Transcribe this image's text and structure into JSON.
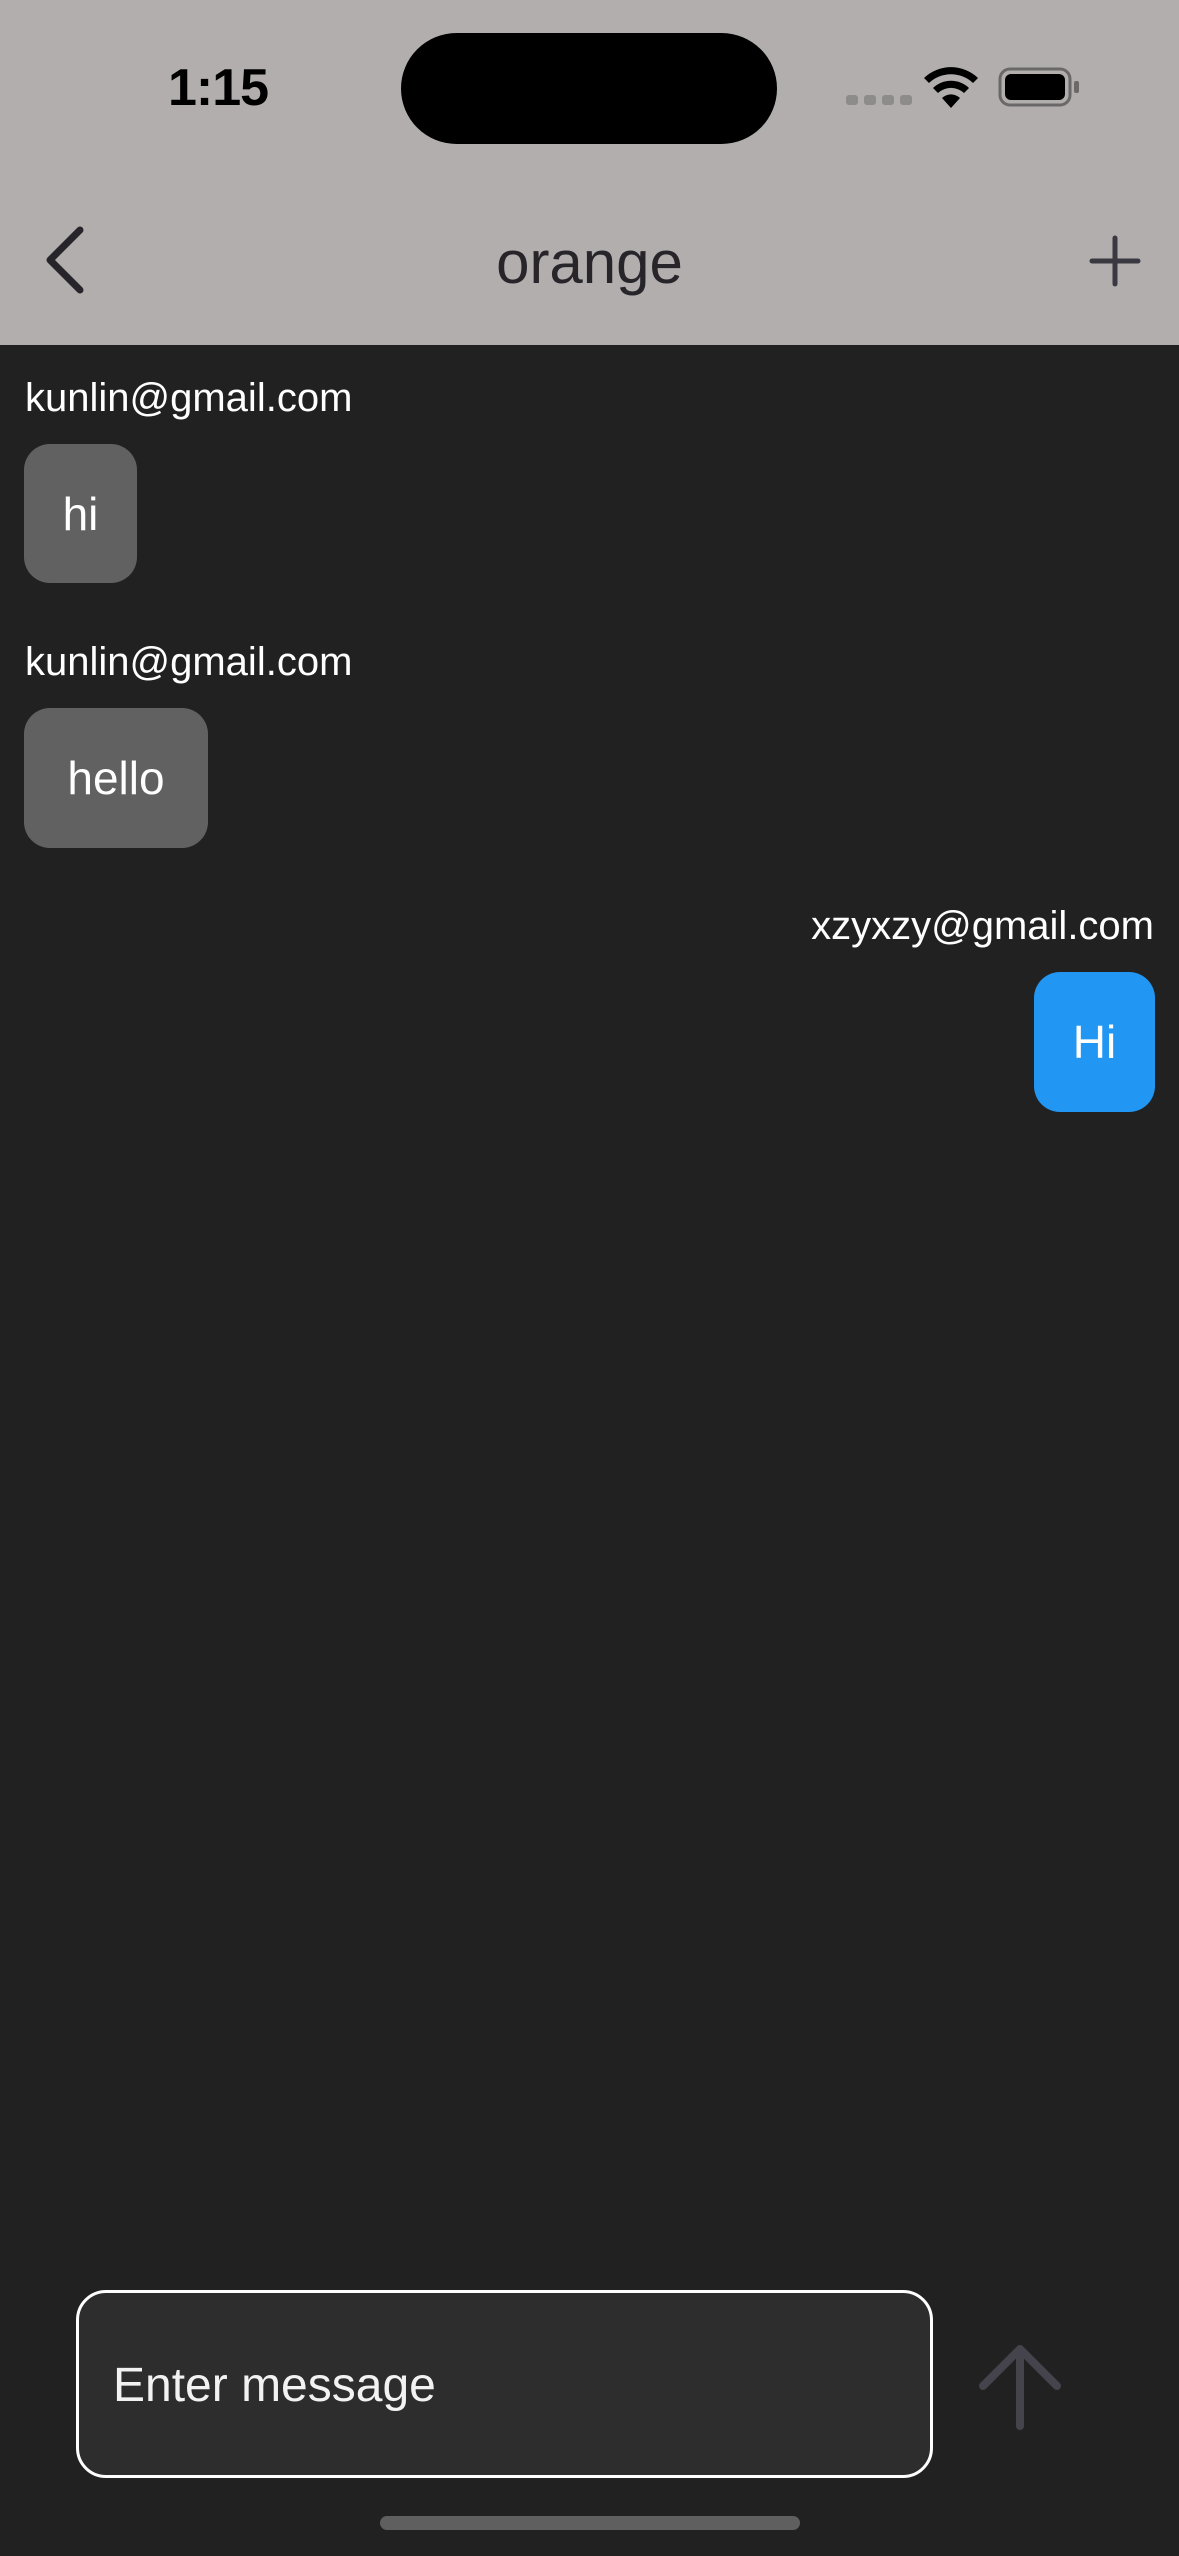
{
  "status_bar": {
    "time": "1:15"
  },
  "header": {
    "title": "orange",
    "back_icon": "chevron-left-icon",
    "add_icon": "plus-icon"
  },
  "messages": [
    {
      "sender": "kunlin@gmail.com",
      "text": "hi",
      "from_me": false
    },
    {
      "sender": "kunlin@gmail.com",
      "text": "hello",
      "from_me": false
    },
    {
      "sender": "xzyxzy@gmail.com",
      "text": "Hi",
      "from_me": true
    }
  ],
  "composer": {
    "placeholder": "Enter message",
    "value": "",
    "send_icon": "arrow-up-icon"
  },
  "colors": {
    "header_bg": "#b2aeae",
    "chat_bg": "#212121",
    "incoming_bubble": "#626161",
    "outgoing_bubble": "#2196f3"
  }
}
